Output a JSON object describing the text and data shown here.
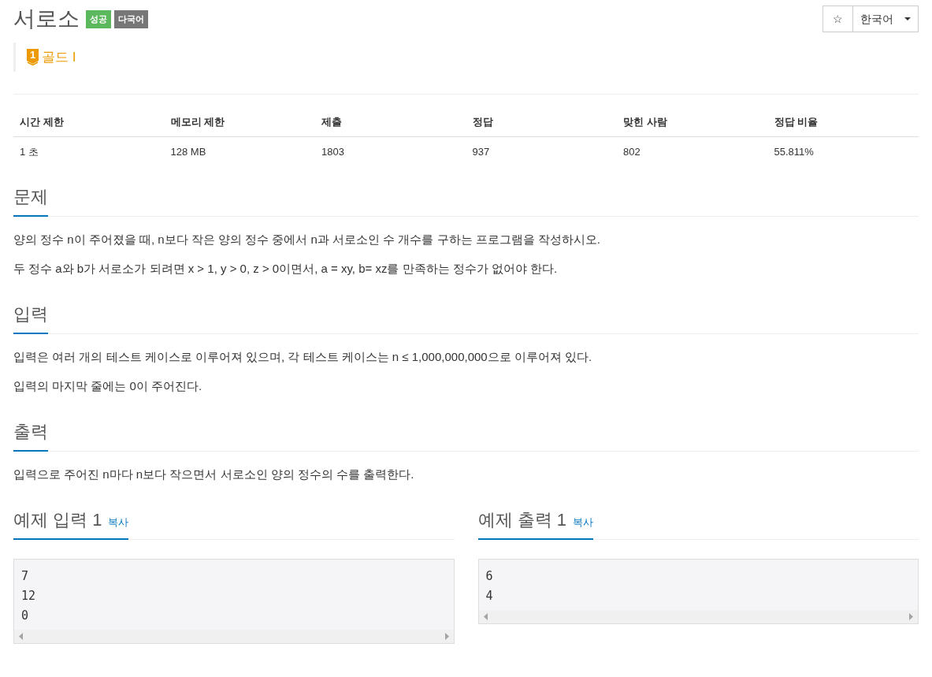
{
  "title": "서로소",
  "badges": [
    {
      "label": "성공",
      "kind": "success"
    },
    {
      "label": "다국어",
      "kind": "multilang"
    }
  ],
  "favorite_button": {
    "label": "☆"
  },
  "language_select": {
    "value": "한국어"
  },
  "tier": {
    "number": "1",
    "label": "골드 I"
  },
  "info_table": {
    "columns": [
      "시간 제한",
      "메모리 제한",
      "제출",
      "정답",
      "맞힌 사람",
      "정답 비율"
    ],
    "rows": [
      [
        "1 초",
        "128 MB",
        "1803",
        "937",
        "802",
        "55.811%"
      ]
    ]
  },
  "sections": [
    {
      "heading": "문제",
      "paragraphs": [
        "양의 정수 n이 주어졌을 때, n보다 작은 양의 정수 중에서 n과 서로소인 수 개수를 구하는 프로그램을 작성하시오.",
        "두 정수 a와 b가 서로소가 되려면 x > 1, y > 0, z > 0이면서, a = xy, b= xz를 만족하는 정수가 없어야 한다."
      ]
    },
    {
      "heading": "입력",
      "paragraphs": [
        "입력은 여러 개의 테스트 케이스로 이루어져 있으며, 각 테스트 케이스는 n ≤ 1,000,000,000으로 이루어져 있다.",
        "입력의 마지막 줄에는 0이 주어진다."
      ]
    },
    {
      "heading": "출력",
      "paragraphs": [
        "입력으로 주어진 n마다 n보다 작으면서 서로소인 양의 정수의 수를 출력한다."
      ]
    }
  ],
  "samples": [
    {
      "heading": "예제 입력 1",
      "copy": "복사",
      "lines": [
        "7",
        "12",
        "0"
      ]
    },
    {
      "heading": "예제 출력 1",
      "copy": "복사",
      "lines": [
        "6",
        "4"
      ]
    }
  ]
}
